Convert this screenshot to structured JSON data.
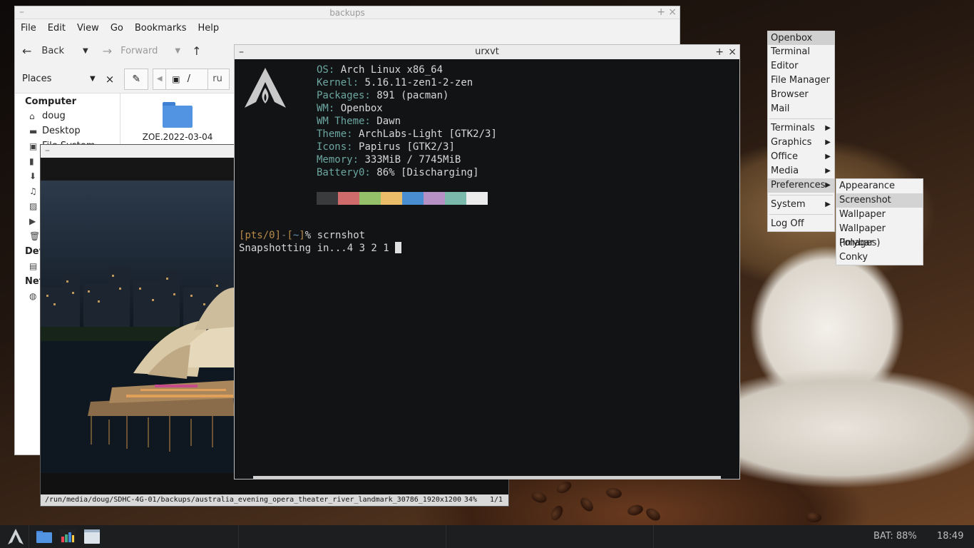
{
  "file_manager": {
    "title": "backups",
    "menu": [
      "File",
      "Edit",
      "View",
      "Go",
      "Bookmarks",
      "Help"
    ],
    "toolbar": {
      "back": "Back",
      "forward": "Forward"
    },
    "places_label": "Places",
    "path_root": "/",
    "path_partial": "ru",
    "sidebar": {
      "computer_heading": "Computer",
      "items": [
        "doug",
        "Desktop",
        "File System"
      ],
      "devices_heading": "Dev",
      "network_heading": "Net"
    },
    "folder_name": "ZOE.2022-03-04"
  },
  "image_viewer": {
    "status_path": "/run/media/doug/SDHC-4G-01/backups/australia_evening_opera_theater_river_landmark_30786_1920x1200",
    "zoom": "34%",
    "page": "1/1"
  },
  "terminal": {
    "title": "urxvt",
    "info": [
      {
        "key": "OS:",
        "value": "Arch Linux x86_64"
      },
      {
        "key": "Kernel:",
        "value": "5.16.11-zen1-2-zen"
      },
      {
        "key": "Packages:",
        "value": "891 (pacman)"
      },
      {
        "key": "WM:",
        "value": "Openbox"
      },
      {
        "key": "WM Theme:",
        "value": "Dawn"
      },
      {
        "key": "Theme:",
        "value": "ArchLabs-Light [GTK2/3]"
      },
      {
        "key": "Icons:",
        "value": "Papirus [GTK2/3]"
      },
      {
        "key": "Memory:",
        "value": "333MiB / 7745MiB"
      },
      {
        "key": "Battery0:",
        "value": "86% [Discharging]"
      }
    ],
    "palette": [
      "#3a3b3d",
      "#d06b6b",
      "#94c06a",
      "#e9bd6a",
      "#4a8ed2",
      "#b591c6",
      "#7bb9ad",
      "#ececec"
    ],
    "prompt": {
      "tty": "pts/0",
      "dir": "~",
      "symbol": "%",
      "command": "scrnshot"
    },
    "output": "Snapshotting in...4 3 2 1 "
  },
  "root_menu": {
    "title": "Openbox",
    "group1": [
      "Terminal",
      "Editor",
      "File Manager",
      "Browser",
      "Mail"
    ],
    "group2": [
      "Terminals",
      "Graphics",
      "Office",
      "Media",
      "Preferences"
    ],
    "group3": [
      "System"
    ],
    "group4": [
      "Log Off"
    ]
  },
  "preferences_submenu": [
    "Appearance",
    "Screenshot",
    "Wallpaper",
    "Wallpaper (images)",
    "Polybar",
    "Conky"
  ],
  "taskbar": {
    "battery": "BAT: 88%",
    "clock": "18:49"
  }
}
